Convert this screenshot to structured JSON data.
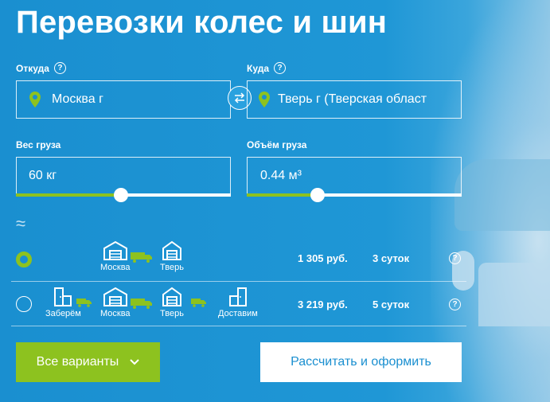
{
  "title": "Перевозки колес и шин",
  "from": {
    "label": "Откуда",
    "help": "?",
    "value": "Москва г"
  },
  "to": {
    "label": "Куда",
    "help": "?",
    "value": "Тверь г (Тверская област"
  },
  "weight": {
    "label": "Вес груза",
    "value": "60 кг",
    "slider_fraction": 0.49
  },
  "volume": {
    "label": "Объём груза",
    "value": "0.44 м³",
    "slider_fraction": 0.33
  },
  "approx_symbol": "≈",
  "options": [
    {
      "selected": true,
      "steps": [
        "Москва",
        "Тверь"
      ],
      "price": "1 305 руб.",
      "days": "3 суток",
      "help": "?"
    },
    {
      "selected": false,
      "steps": [
        "Заберём",
        "Москва",
        "Тверь",
        "Доставим"
      ],
      "price": "3 219 руб.",
      "days": "5 суток",
      "help": "?"
    }
  ],
  "buttons": {
    "variants": "Все варианты",
    "calculate": "Рассчитать и оформить"
  },
  "colors": {
    "background": "#1a8fd0",
    "accent_green": "#8dc21f",
    "text": "#ffffff"
  }
}
